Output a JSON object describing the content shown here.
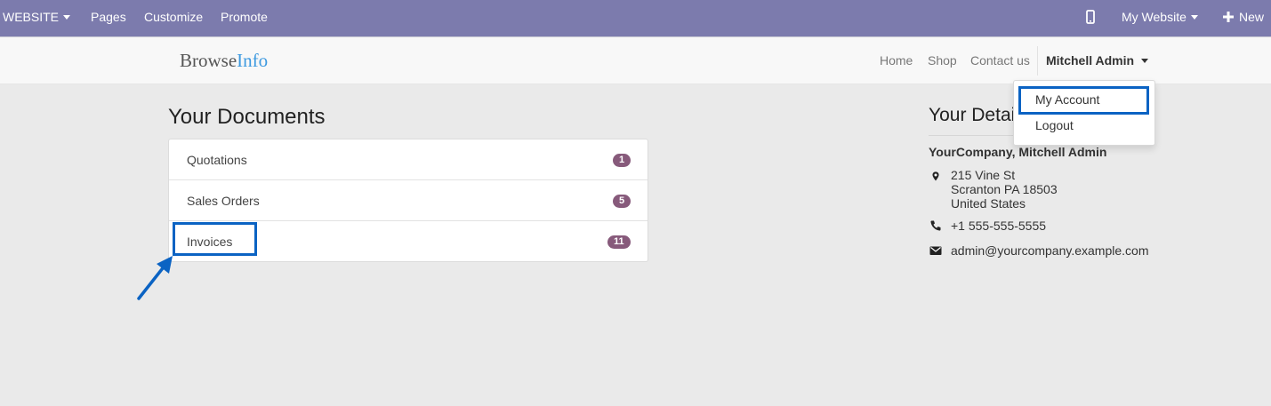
{
  "topbar": {
    "website_label": "WEBSITE",
    "pages_label": "Pages",
    "customize_label": "Customize",
    "promote_label": "Promote",
    "my_website_label": "My Website",
    "new_label": "New"
  },
  "navbar": {
    "logo_part1": "Browse",
    "logo_part2": "Info",
    "home_label": "Home",
    "shop_label": "Shop",
    "contact_label": "Contact us",
    "user_label": "Mitchell Admin"
  },
  "dropdown": {
    "my_account_label": "My Account",
    "logout_label": "Logout"
  },
  "documents": {
    "title": "Your Documents",
    "items": [
      {
        "label": "Quotations",
        "count": "1"
      },
      {
        "label": "Sales Orders",
        "count": "5"
      },
      {
        "label": "Invoices",
        "count": "11"
      }
    ]
  },
  "details": {
    "title": "Your Details",
    "company": "YourCompany, Mitchell Admin",
    "address_line1": "215 Vine St",
    "address_line2": "Scranton PA 18503",
    "address_line3": "United States",
    "phone": "+1 555-555-5555",
    "email": "admin@yourcompany.example.com"
  },
  "colors": {
    "topbar": "#7c7bad",
    "badge": "#875a7b",
    "highlight": "#0b63c3",
    "logo_accent": "#3e9ae0"
  }
}
